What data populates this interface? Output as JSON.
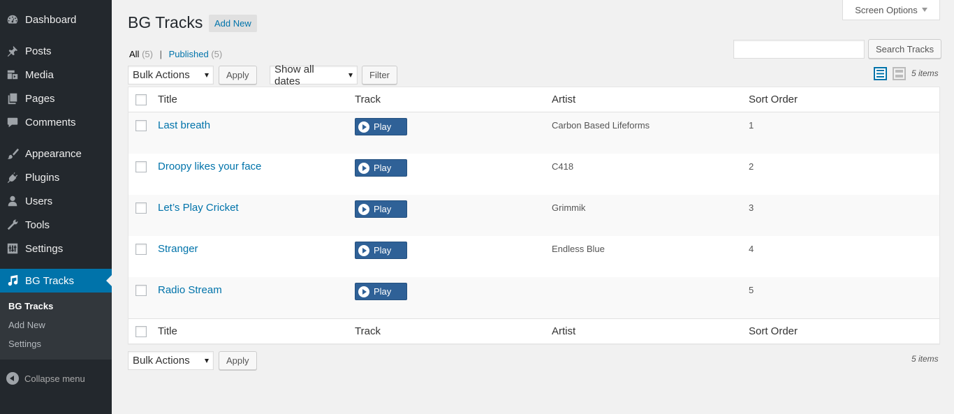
{
  "sidebar": {
    "items": [
      {
        "label": "Dashboard",
        "icon": "dashboard-icon"
      },
      {
        "label": "Posts",
        "icon": "pin-icon"
      },
      {
        "label": "Media",
        "icon": "media-icon"
      },
      {
        "label": "Pages",
        "icon": "pages-icon"
      },
      {
        "label": "Comments",
        "icon": "comment-icon"
      },
      {
        "label": "Appearance",
        "icon": "brush-icon"
      },
      {
        "label": "Plugins",
        "icon": "plug-icon"
      },
      {
        "label": "Users",
        "icon": "user-icon"
      },
      {
        "label": "Tools",
        "icon": "wrench-icon"
      },
      {
        "label": "Settings",
        "icon": "sliders-icon"
      },
      {
        "label": "BG Tracks",
        "icon": "music-note-icon"
      }
    ],
    "submenu": [
      "BG Tracks",
      "Add New",
      "Settings"
    ],
    "collapse_label": "Collapse menu",
    "accent": "#0073aa"
  },
  "header": {
    "title": "BG Tracks",
    "add_new": "Add New",
    "screen_options": "Screen Options"
  },
  "views": {
    "all_label": "All",
    "all_count": "(5)",
    "sep": "|",
    "published_label": "Published",
    "published_count": "(5)"
  },
  "search": {
    "value": "",
    "button": "Search Tracks"
  },
  "toolbar": {
    "bulk_actions": "Bulk Actions",
    "apply": "Apply",
    "dates": "Show all dates",
    "filter": "Filter",
    "items_count": "5 items"
  },
  "table": {
    "columns": [
      "Title",
      "Track",
      "Artist",
      "Sort Order"
    ],
    "play_label": "Play",
    "rows": [
      {
        "title": "Last breath",
        "artist": "Carbon Based Lifeforms",
        "order": "1"
      },
      {
        "title": "Droopy likes your face",
        "artist": "C418",
        "order": "2"
      },
      {
        "title": "Let’s Play Cricket",
        "artist": "Grimmik",
        "order": "3"
      },
      {
        "title": "Stranger",
        "artist": "Endless Blue",
        "order": "4"
      },
      {
        "title": "Radio Stream",
        "artist": "",
        "order": "5"
      }
    ]
  }
}
